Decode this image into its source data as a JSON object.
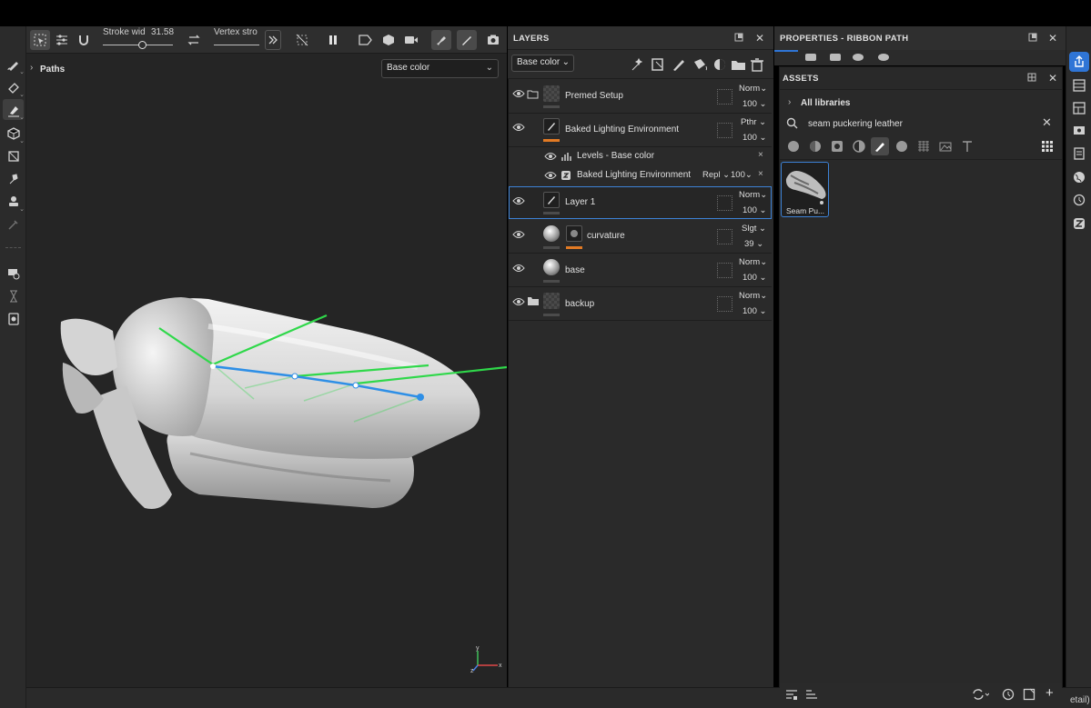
{
  "viewport": {
    "paths_label": "Paths",
    "channel_select": "Base color",
    "stroke_width_label": "Stroke wid",
    "stroke_width_value": "31.58",
    "vertex_label": "Vertex stro",
    "axis_labels": {
      "x": "x",
      "y": "y",
      "z": "z"
    }
  },
  "layers_panel": {
    "title": "LAYERS",
    "channel": "Base color",
    "layers": [
      {
        "name": "Premed Setup",
        "blend": "Norm",
        "opacity": "100"
      },
      {
        "name": "Baked Lighting Environment",
        "blend": "Pthr",
        "opacity": "100"
      },
      {
        "name": "Levels - Base color"
      },
      {
        "name": "Baked Lighting Environment",
        "blend": "Repl",
        "opacity": "100"
      },
      {
        "name": "Layer 1",
        "blend": "Norm",
        "opacity": "100"
      },
      {
        "name": "curvature",
        "blend": "Slgt",
        "opacity": "39"
      },
      {
        "name": "base",
        "blend": "Norm",
        "opacity": "100"
      },
      {
        "name": "backup",
        "blend": "Norm",
        "opacity": "100"
      }
    ]
  },
  "properties_panel": {
    "title": "PROPERTIES - RIBBON PATH"
  },
  "assets_panel": {
    "title": "ASSETS",
    "library": "All libraries",
    "search_value": "seam puckering leather",
    "results": [
      {
        "label": "Seam Pu..."
      }
    ]
  },
  "status": {
    "detail_text": "etail)"
  },
  "colors": {
    "accent": "#2f75d6",
    "selection": "#3d82d6",
    "orange": "#e27a24",
    "path": "#2e8fe6",
    "handles": "#2fd84a"
  }
}
